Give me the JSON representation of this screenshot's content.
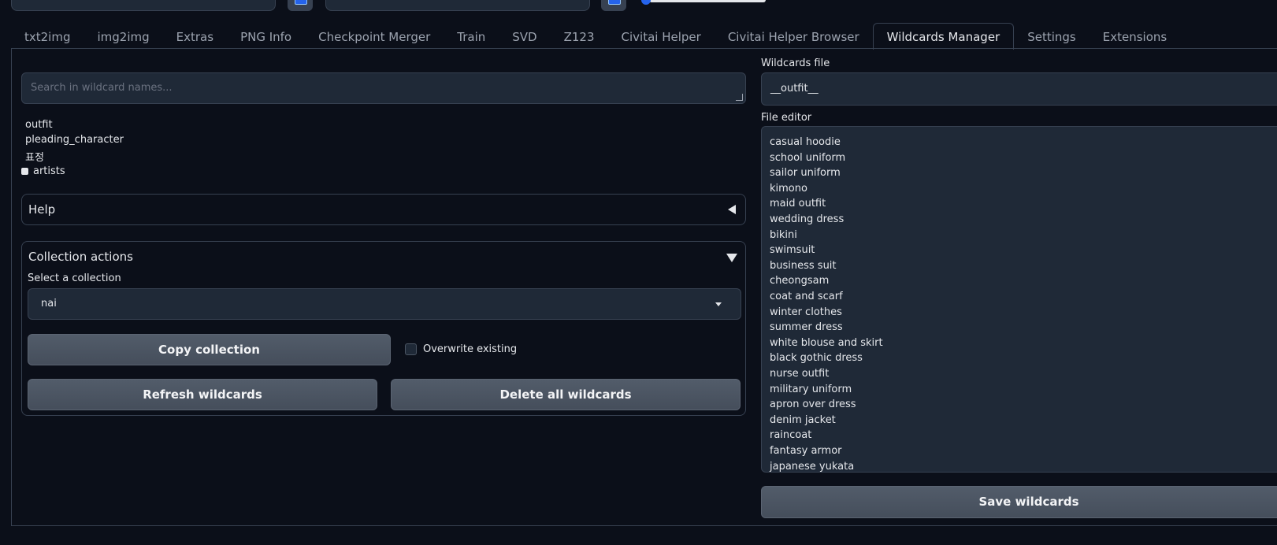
{
  "tabs": [
    "txt2img",
    "img2img",
    "Extras",
    "PNG Info",
    "Checkpoint Merger",
    "Train",
    "SVD",
    "Z123",
    "Civitai Helper",
    "Civitai Helper Browser",
    "Wildcards Manager",
    "Settings",
    "Extensions"
  ],
  "active_tab": "Wildcards Manager",
  "search": {
    "placeholder": "Search in wildcard names..."
  },
  "tree": {
    "items": [
      "outfit",
      "pleading_character",
      "표정"
    ],
    "folder": "artists"
  },
  "help": {
    "title": "Help"
  },
  "collection": {
    "title": "Collection actions",
    "select_label": "Select a collection",
    "selected": "nai",
    "copy_label": "Copy collection",
    "overwrite_label": "Overwrite existing",
    "refresh_label": "Refresh wildcards",
    "delete_label": "Delete all wildcards"
  },
  "file": {
    "label": "Wildcards file",
    "value": "__outfit__",
    "editor_label": "File editor",
    "lines": [
      "casual hoodie",
      "school uniform",
      "sailor uniform",
      "kimono",
      "maid outfit",
      "wedding dress",
      "bikini",
      "swimsuit",
      "business suit",
      "cheongsam",
      "coat and scarf",
      "winter clothes",
      "summer dress",
      "white blouse and skirt",
      "black gothic dress",
      "nurse outfit",
      "military uniform",
      "apron over dress",
      "denim jacket",
      "raincoat",
      "fantasy armor",
      "japanese yukata"
    ],
    "save_label": "Save wildcards"
  },
  "colors": {
    "background": "#0b0f19",
    "input": "#1f2937",
    "border": "#374151",
    "accent": "#2563eb",
    "button": "#4b5563"
  }
}
